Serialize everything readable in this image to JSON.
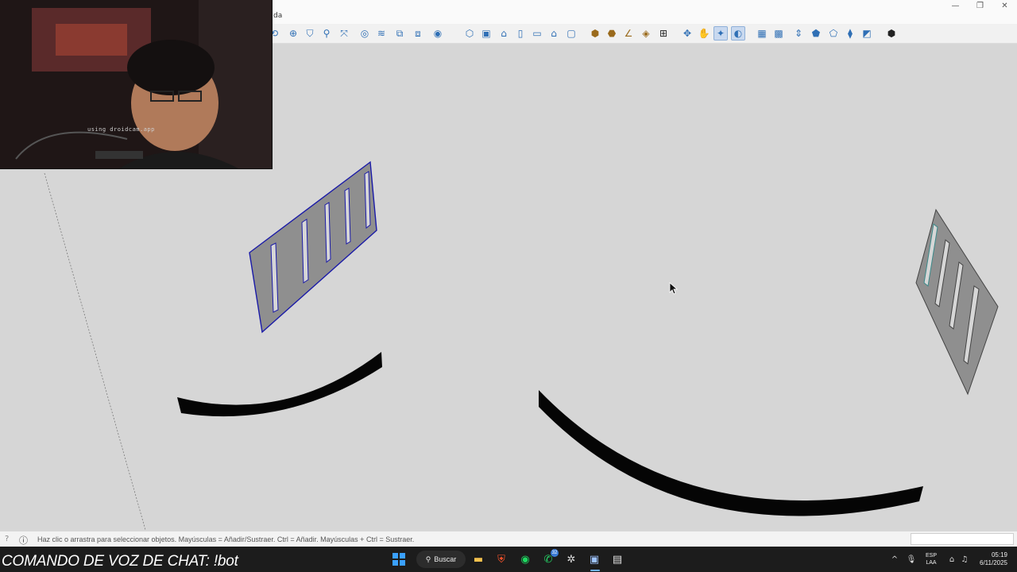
{
  "app": {
    "menu_fragment": "da",
    "window_controls": {
      "minimize": "—",
      "maximize": "❐",
      "close": "✕"
    }
  },
  "toolbar": {
    "icons": [
      {
        "name": "orbit-fragment-icon",
        "glyph": "⟲",
        "tone": "blue"
      },
      {
        "name": "section-plane-icon",
        "glyph": "⊕",
        "tone": "blue"
      },
      {
        "name": "paint-bucket-icon",
        "glyph": "⛉",
        "tone": "blue"
      },
      {
        "name": "zoom-icon",
        "glyph": "⚲",
        "tone": "blue"
      },
      {
        "name": "zoom-extents-icon",
        "glyph": "⤧",
        "tone": "blue"
      },
      {
        "name": "x-ray-icon",
        "glyph": "◎",
        "tone": "blue"
      },
      {
        "name": "back-edges-icon",
        "glyph": "≋",
        "tone": "blue"
      },
      {
        "name": "wireframe-icon",
        "glyph": "⧉",
        "tone": "blue"
      },
      {
        "name": "hidden-line-icon",
        "glyph": "⧈",
        "tone": "blue"
      },
      {
        "name": "styles-dropdown-icon",
        "glyph": "◉",
        "tone": "blue"
      },
      {
        "name": "iso-view-icon",
        "glyph": "⬡",
        "tone": "blue"
      },
      {
        "name": "top-view-icon",
        "glyph": "▣",
        "tone": "blue"
      },
      {
        "name": "front-view-icon",
        "glyph": "⌂",
        "tone": "blue"
      },
      {
        "name": "right-view-icon",
        "glyph": "▯",
        "tone": "blue"
      },
      {
        "name": "back-view-icon",
        "glyph": "▭",
        "tone": "blue"
      },
      {
        "name": "left-view-icon",
        "glyph": "⌂",
        "tone": "blue"
      },
      {
        "name": "bottom-view-icon",
        "glyph": "▢",
        "tone": "blue"
      },
      {
        "name": "component-icon",
        "glyph": "⬢",
        "tone": "tan"
      },
      {
        "name": "group-icon",
        "glyph": "⬣",
        "tone": "tan"
      },
      {
        "name": "tape-measure-icon",
        "glyph": "∠",
        "tone": "tan"
      },
      {
        "name": "layers-icon",
        "glyph": "◈",
        "tone": "tan"
      },
      {
        "name": "outliner-icon",
        "glyph": "⊞",
        "tone": "dark"
      },
      {
        "name": "pan-icon",
        "glyph": "✥",
        "tone": "blue"
      },
      {
        "name": "hand-icon",
        "glyph": "✋",
        "tone": "blue"
      },
      {
        "name": "orbit-active-icon",
        "glyph": "✦",
        "tone": "blue",
        "active": true
      },
      {
        "name": "globe-active-icon",
        "glyph": "◐",
        "tone": "blue",
        "active": true
      },
      {
        "name": "sandbox-icon",
        "glyph": "▦",
        "tone": "blue"
      },
      {
        "name": "terrain-icon",
        "glyph": "▩",
        "tone": "blue"
      },
      {
        "name": "push-pull-icon",
        "glyph": "⇕",
        "tone": "blue"
      },
      {
        "name": "smoove-icon",
        "glyph": "⬟",
        "tone": "blue"
      },
      {
        "name": "stamp-icon",
        "glyph": "⬠",
        "tone": "blue"
      },
      {
        "name": "drape-icon",
        "glyph": "⧫",
        "tone": "blue"
      },
      {
        "name": "flip-edge-icon",
        "glyph": "◩",
        "tone": "blue"
      },
      {
        "name": "extension-icon",
        "glyph": "⬢",
        "tone": "dark"
      }
    ]
  },
  "webcam": {
    "caption": "using droidcam.app"
  },
  "status": {
    "help_icon": "?",
    "info_icon": "ⓘ",
    "hint": "Haz clic o arrastra para seleccionar objetos. Mayúsculas = Añadir/Sustraer. Ctrl = Añadir. Mayúsculas + Ctrl = Sustraer."
  },
  "taskbar": {
    "chat_command": "COMANDO DE VOZ DE CHAT: !bot",
    "search_label": "Buscar",
    "search_icon": "⚲",
    "whatsapp_badge": "32",
    "tray": {
      "chevron": "^",
      "mic": "🎙",
      "lang_line1": "ESP",
      "lang_line2": "LAA",
      "network": "⌂",
      "volume": "♫",
      "battery": "▭"
    },
    "time": "05:19",
    "date": "6/11/2025"
  },
  "colors": {
    "viewport_bg": "#d6d6d6",
    "selection_blue": "#1a1aa8",
    "panel_grey": "#8f8f8f",
    "arc_black": "#050505"
  }
}
